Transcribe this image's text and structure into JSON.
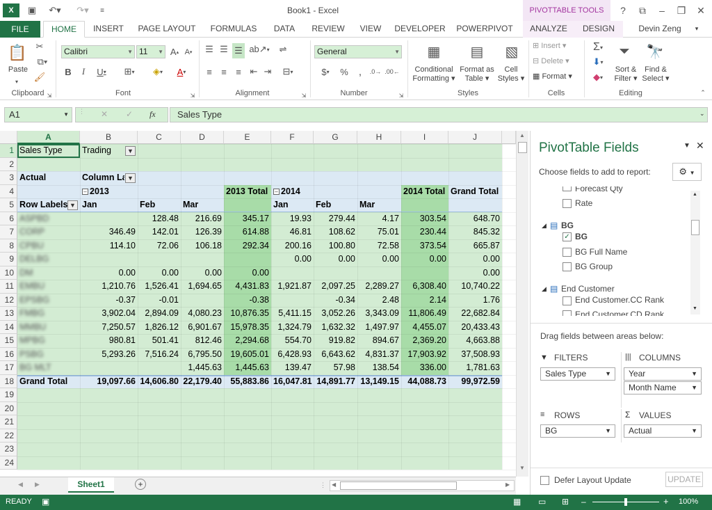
{
  "window": {
    "title": "Book1 - Excel",
    "user": "Devin Zeng",
    "pt_tools": "PIVOTTABLE TOOLS"
  },
  "tabs": [
    "FILE",
    "HOME",
    "INSERT",
    "PAGE LAYOUT",
    "FORMULAS",
    "DATA",
    "REVIEW",
    "VIEW",
    "DEVELOPER",
    "POWERPIVOT",
    "ANALYZE",
    "DESIGN"
  ],
  "ribbon": {
    "clipboard": {
      "paste": "Paste",
      "label": "Clipboard"
    },
    "font": {
      "name": "Calibri",
      "size": "11",
      "label": "Font"
    },
    "alignment": {
      "label": "Alignment"
    },
    "number": {
      "format": "General",
      "label": "Number"
    },
    "styles": {
      "cond": "Conditional",
      "cond2": "Formatting",
      "fmt_table": "Format as",
      "fmt_table2": "Table",
      "cell_styles": "Cell",
      "cell_styles2": "Styles",
      "label": "Styles"
    },
    "cells": {
      "insert": "Insert",
      "delete": "Delete",
      "format": "Format",
      "label": "Cells"
    },
    "editing": {
      "sort": "Sort &",
      "sort2": "Filter",
      "find": "Find &",
      "find2": "Select",
      "label": "Editing"
    }
  },
  "formula_bar": {
    "name_box": "A1",
    "fx": "fx",
    "formula": "Sales Type"
  },
  "columns": [
    "A",
    "B",
    "C",
    "D",
    "E",
    "F",
    "G",
    "H",
    "I",
    "J"
  ],
  "rows": [
    "1",
    "2",
    "3",
    "4",
    "5",
    "6",
    "7",
    "8",
    "9",
    "10",
    "11",
    "12",
    "13",
    "14",
    "15",
    "16",
    "17",
    "18",
    "19",
    "20",
    "21",
    "22",
    "23",
    "24"
  ],
  "pivot": {
    "r1": {
      "a": "Sales Type",
      "b": "Trading"
    },
    "r3": {
      "a": "Actual",
      "b": "Column La"
    },
    "r4": {
      "b": "2013",
      "e": "2013 Total",
      "f": "2014",
      "i": "2014 Total",
      "j": "Grand Total"
    },
    "r5": {
      "a": "Row Labels",
      "b": "Jan",
      "c": "Feb",
      "d": "Mar",
      "f": "Jan",
      "g": "Feb",
      "h": "Mar"
    },
    "data": [
      {
        "label": "ASPBD",
        "b": "",
        "c": "128.48",
        "d": "216.69",
        "e": "345.17",
        "f": "19.93",
        "g": "279.44",
        "h": "4.17",
        "i": "303.54",
        "j": "648.70"
      },
      {
        "label": "CORP",
        "b": "346.49",
        "c": "142.01",
        "d": "126.39",
        "e": "614.88",
        "f": "46.81",
        "g": "108.62",
        "h": "75.01",
        "i": "230.44",
        "j": "845.32"
      },
      {
        "label": "CPBU",
        "b": "114.10",
        "c": "72.06",
        "d": "106.18",
        "e": "292.34",
        "f": "200.16",
        "g": "100.80",
        "h": "72.58",
        "i": "373.54",
        "j": "665.87"
      },
      {
        "label": "DELBG",
        "b": "",
        "c": "",
        "d": "",
        "e": "",
        "f": "0.00",
        "g": "0.00",
        "h": "0.00",
        "i": "0.00",
        "j": "0.00"
      },
      {
        "label": "DM",
        "b": "0.00",
        "c": "0.00",
        "d": "0.00",
        "e": "0.00",
        "f": "",
        "g": "",
        "h": "",
        "i": "",
        "j": "0.00"
      },
      {
        "label": "EMBU",
        "b": "1,210.76",
        "c": "1,526.41",
        "d": "1,694.65",
        "e": "4,431.83",
        "f": "1,921.87",
        "g": "2,097.25",
        "h": "2,289.27",
        "i": "6,308.40",
        "j": "10,740.22"
      },
      {
        "label": "EPSBG",
        "b": "-0.37",
        "c": "-0.01",
        "d": "",
        "e": "-0.38",
        "f": "",
        "g": "-0.34",
        "h": "2.48",
        "i": "2.14",
        "j": "1.76"
      },
      {
        "label": "FMBG",
        "b": "3,902.04",
        "c": "2,894.09",
        "d": "4,080.23",
        "e": "10,876.35",
        "f": "5,411.15",
        "g": "3,052.26",
        "h": "3,343.09",
        "i": "11,806.49",
        "j": "22,682.84"
      },
      {
        "label": "MMBU",
        "b": "7,250.57",
        "c": "1,826.12",
        "d": "6,901.67",
        "e": "15,978.35",
        "f": "1,324.79",
        "g": "1,632.32",
        "h": "1,497.97",
        "i": "4,455.07",
        "j": "20,433.43"
      },
      {
        "label": "MPBG",
        "b": "980.81",
        "c": "501.41",
        "d": "812.46",
        "e": "2,294.68",
        "f": "554.70",
        "g": "919.82",
        "h": "894.67",
        "i": "2,369.20",
        "j": "4,663.88"
      },
      {
        "label": "PSBG",
        "b": "5,293.26",
        "c": "7,516.24",
        "d": "6,795.50",
        "e": "19,605.01",
        "f": "6,428.93",
        "g": "6,643.62",
        "h": "4,831.37",
        "i": "17,903.92",
        "j": "37,508.93"
      },
      {
        "label": "BG MLT",
        "b": "",
        "c": "",
        "d": "1,445.63",
        "e": "1,445.63",
        "f": "139.47",
        "g": "57.98",
        "h": "138.54",
        "i": "336.00",
        "j": "1,781.63"
      }
    ],
    "total": {
      "label": "Grand Total",
      "b": "19,097.66",
      "c": "14,606.80",
      "d": "22,179.40",
      "e": "55,883.86",
      "f": "16,047.81",
      "g": "14,891.77",
      "h": "13,149.15",
      "i": "44,088.73",
      "j": "99,972.59"
    }
  },
  "sheet": {
    "tab": "Sheet1"
  },
  "status": {
    "ready": "READY",
    "zoom": "100%"
  },
  "pane": {
    "title": "PivotTable Fields",
    "choose": "Choose fields to add to report:",
    "fields": [
      "Forecast Qty",
      "Rate",
      "BG",
      "BG",
      "BG Full Name",
      "BG Group",
      "End Customer",
      "End Customer.CC Rank",
      "End Customer.CD Rank"
    ],
    "drag": "Drag fields between areas below:",
    "filters": "FILTERS",
    "columns": "COLUMNS",
    "rows": "ROWS",
    "values": "VALUES",
    "filter_item": "Sales Type",
    "col_item1": "Year",
    "col_item2": "Month Name",
    "row_item": "BG",
    "val_item": "Actual",
    "defer": "Defer Layout Update",
    "update": "UPDATE"
  }
}
